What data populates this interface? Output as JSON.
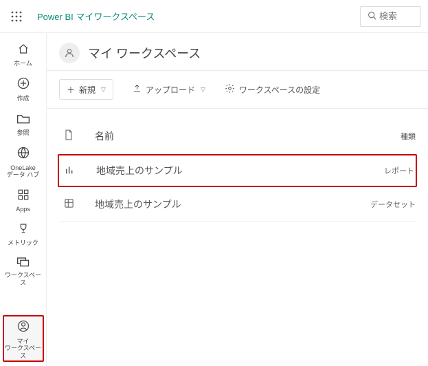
{
  "header": {
    "brand": "Power BI マイワークスペース",
    "search_placeholder": "検索"
  },
  "rail": {
    "home": "ホーム",
    "create": "作成",
    "browse": "参照",
    "onelake": "OneLake",
    "onelake_sub": "データ ハブ",
    "apps": "Apps",
    "metric": "メトリック",
    "workspaces": "ワークスペース",
    "myws_l1": "マイ",
    "myws_l2": "ワークスペース"
  },
  "workspace": {
    "title": "マイ ワークスペース"
  },
  "toolbar": {
    "new_label": "新規",
    "upload_label": "アップロード",
    "settings_label": "ワークスペースの設定"
  },
  "columns": {
    "name": "名前",
    "type": "種類"
  },
  "items": [
    {
      "name": "地域売上のサンプル",
      "type": "レポート"
    },
    {
      "name": "地域売上のサンプル",
      "type": "データセット"
    }
  ]
}
